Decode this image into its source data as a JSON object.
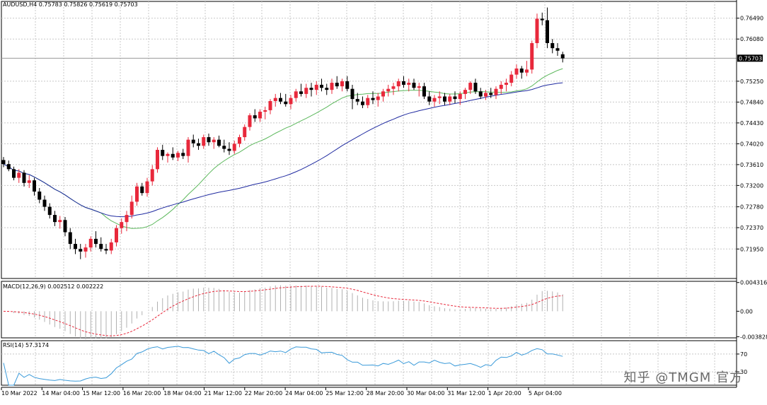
{
  "watermark": "知乎 @TMGM 官方",
  "chart_data": [
    {
      "type": "candlestick",
      "title": "AUDUSD,H4  0.75783 0.75826 0.75619 0.75703",
      "ylim": [
        0.7137,
        0.7682
      ],
      "y_ticks": [
        "0.76490",
        "0.76080",
        "0.75250",
        "0.74840",
        "0.74430",
        "0.74020",
        "0.73610",
        "0.73200",
        "0.72780",
        "0.72370",
        "0.71950"
      ],
      "current_price": "0.75703",
      "x_ticks": [
        "10 Mar 2022",
        "14 Mar 04:00",
        "15 Mar 12:00",
        "16 Mar 20:00",
        "18 Mar 04:00",
        "21 Mar 12:00",
        "22 Mar 20:00",
        "24 Mar 04:00",
        "25 Mar 12:00",
        "28 Mar 20:00",
        "30 Mar 04:00",
        "31 Mar 12:00",
        "1 Apr 20:00",
        "5 Apr 04:00"
      ],
      "up_color": "#e8283b",
      "down_color": "#000000",
      "candles": [
        [
          0.737,
          0.7376,
          0.7356,
          0.7362
        ],
        [
          0.7362,
          0.7369,
          0.7348,
          0.7352
        ],
        [
          0.7352,
          0.7357,
          0.733,
          0.7335
        ],
        [
          0.7335,
          0.7352,
          0.7325,
          0.7345
        ],
        [
          0.7345,
          0.735,
          0.7318,
          0.7325
        ],
        [
          0.7325,
          0.734,
          0.7315,
          0.733
        ],
        [
          0.733,
          0.7335,
          0.73,
          0.7308
        ],
        [
          0.7308,
          0.7315,
          0.7285,
          0.7292
        ],
        [
          0.7292,
          0.73,
          0.727,
          0.7278
        ],
        [
          0.7278,
          0.7285,
          0.7255,
          0.7262
        ],
        [
          0.7262,
          0.727,
          0.724,
          0.7248
        ],
        [
          0.7248,
          0.726,
          0.7235,
          0.7252
        ],
        [
          0.7252,
          0.7258,
          0.722,
          0.7228
        ],
        [
          0.7228,
          0.7236,
          0.7195,
          0.7205
        ],
        [
          0.7205,
          0.7215,
          0.7185,
          0.7195
        ],
        [
          0.7195,
          0.7205,
          0.7175,
          0.719
        ],
        [
          0.719,
          0.7205,
          0.7178,
          0.7198
        ],
        [
          0.7198,
          0.722,
          0.719,
          0.7215
        ],
        [
          0.7215,
          0.723,
          0.7198,
          0.7205
        ],
        [
          0.7205,
          0.7218,
          0.719,
          0.7195
        ],
        [
          0.7195,
          0.7205,
          0.7185,
          0.7192
        ],
        [
          0.7192,
          0.7215,
          0.7185,
          0.7208
        ],
        [
          0.7208,
          0.7242,
          0.72,
          0.7236
        ],
        [
          0.7236,
          0.7255,
          0.7225,
          0.7248
        ],
        [
          0.7248,
          0.727,
          0.723,
          0.7262
        ],
        [
          0.7262,
          0.73,
          0.7255,
          0.7288
        ],
        [
          0.7288,
          0.7325,
          0.728,
          0.7318
        ],
        [
          0.7318,
          0.7325,
          0.73,
          0.7305
        ],
        [
          0.7305,
          0.7335,
          0.7298,
          0.7328
        ],
        [
          0.7328,
          0.736,
          0.732,
          0.7352
        ],
        [
          0.7352,
          0.7395,
          0.7345,
          0.739
        ],
        [
          0.739,
          0.74,
          0.737,
          0.7378
        ],
        [
          0.7378,
          0.7385,
          0.7365,
          0.7382
        ],
        [
          0.7382,
          0.7395,
          0.737,
          0.7375
        ],
        [
          0.7375,
          0.7388,
          0.7368,
          0.7384
        ],
        [
          0.7384,
          0.7392,
          0.7372,
          0.7378
        ],
        [
          0.7378,
          0.7415,
          0.7365,
          0.741
        ],
        [
          0.741,
          0.742,
          0.7395,
          0.7403
        ],
        [
          0.7403,
          0.7412,
          0.739,
          0.7398
        ],
        [
          0.7398,
          0.742,
          0.7392,
          0.7415
        ],
        [
          0.7415,
          0.7422,
          0.7398,
          0.7405
        ],
        [
          0.7405,
          0.7415,
          0.7392,
          0.741
        ],
        [
          0.741,
          0.7418,
          0.7395,
          0.7398
        ],
        [
          0.7398,
          0.741,
          0.7385,
          0.7392
        ],
        [
          0.7392,
          0.7405,
          0.738,
          0.7388
        ],
        [
          0.7388,
          0.7408,
          0.7382,
          0.7402
        ],
        [
          0.7402,
          0.742,
          0.7395,
          0.7415
        ],
        [
          0.7415,
          0.744,
          0.7408,
          0.7435
        ],
        [
          0.7435,
          0.7462,
          0.7428,
          0.7458
        ],
        [
          0.7458,
          0.747,
          0.7445,
          0.7452
        ],
        [
          0.7452,
          0.747,
          0.7445,
          0.7465
        ],
        [
          0.7465,
          0.7475,
          0.745,
          0.7468
        ],
        [
          0.7468,
          0.749,
          0.746,
          0.7486
        ],
        [
          0.7486,
          0.75,
          0.7475,
          0.7492
        ],
        [
          0.7492,
          0.7502,
          0.748,
          0.7485
        ],
        [
          0.7485,
          0.75,
          0.7475,
          0.748
        ],
        [
          0.748,
          0.7498,
          0.747,
          0.7492
        ],
        [
          0.7492,
          0.751,
          0.7485,
          0.7505
        ],
        [
          0.7505,
          0.752,
          0.7495,
          0.75
        ],
        [
          0.75,
          0.752,
          0.7492,
          0.7512
        ],
        [
          0.7512,
          0.7522,
          0.7495,
          0.7508
        ],
        [
          0.7508,
          0.7525,
          0.7498,
          0.7518
        ],
        [
          0.7518,
          0.753,
          0.7505,
          0.7512
        ],
        [
          0.7512,
          0.752,
          0.7498,
          0.7508
        ],
        [
          0.7508,
          0.753,
          0.75,
          0.7522
        ],
        [
          0.7522,
          0.7535,
          0.751,
          0.7515
        ],
        [
          0.7515,
          0.753,
          0.7505,
          0.7525
        ],
        [
          0.7525,
          0.7535,
          0.7505,
          0.751
        ],
        [
          0.751,
          0.7518,
          0.747,
          0.749
        ],
        [
          0.749,
          0.7502,
          0.7478,
          0.7485
        ],
        [
          0.7485,
          0.7495,
          0.7472,
          0.7478
        ],
        [
          0.7478,
          0.7498,
          0.7472,
          0.7492
        ],
        [
          0.7492,
          0.7505,
          0.748,
          0.7488
        ],
        [
          0.7488,
          0.7502,
          0.7475,
          0.7495
        ],
        [
          0.7495,
          0.751,
          0.7485,
          0.7505
        ],
        [
          0.7505,
          0.7518,
          0.7495,
          0.751
        ],
        [
          0.751,
          0.7522,
          0.7498,
          0.7515
        ],
        [
          0.7515,
          0.753,
          0.7505,
          0.7525
        ],
        [
          0.7525,
          0.7535,
          0.7512,
          0.7518
        ],
        [
          0.7518,
          0.753,
          0.7505,
          0.7522
        ],
        [
          0.7522,
          0.753,
          0.7508,
          0.7512
        ],
        [
          0.7512,
          0.7522,
          0.7495,
          0.7515
        ],
        [
          0.7515,
          0.7522,
          0.749,
          0.7495
        ],
        [
          0.7495,
          0.7505,
          0.7478,
          0.7485
        ],
        [
          0.7485,
          0.7498,
          0.7475,
          0.7492
        ],
        [
          0.7492,
          0.7505,
          0.748,
          0.7495
        ],
        [
          0.7495,
          0.7502,
          0.7478,
          0.7485
        ],
        [
          0.7485,
          0.75,
          0.7478,
          0.7495
        ],
        [
          0.7495,
          0.7505,
          0.7482,
          0.749
        ],
        [
          0.749,
          0.7505,
          0.7478,
          0.75
        ],
        [
          0.75,
          0.7512,
          0.749,
          0.7508
        ],
        [
          0.7508,
          0.7525,
          0.75,
          0.7522
        ],
        [
          0.7522,
          0.753,
          0.75,
          0.7505
        ],
        [
          0.7505,
          0.7512,
          0.749,
          0.7495
        ],
        [
          0.7495,
          0.7508,
          0.7488,
          0.7502
        ],
        [
          0.7502,
          0.7512,
          0.7492,
          0.7498
        ],
        [
          0.7498,
          0.7515,
          0.749,
          0.751
        ],
        [
          0.751,
          0.7525,
          0.75,
          0.7518
        ],
        [
          0.7518,
          0.753,
          0.7505,
          0.7522
        ],
        [
          0.7522,
          0.7545,
          0.7515,
          0.7538
        ],
        [
          0.7538,
          0.7558,
          0.753,
          0.755
        ],
        [
          0.755,
          0.7555,
          0.753,
          0.7542
        ],
        [
          0.7542,
          0.7565,
          0.7535,
          0.7548
        ],
        [
          0.7548,
          0.7605,
          0.754,
          0.76
        ],
        [
          0.76,
          0.7658,
          0.759,
          0.7648
        ],
        [
          0.7648,
          0.766,
          0.7635,
          0.7645
        ],
        [
          0.7645,
          0.767,
          0.759,
          0.76
        ],
        [
          0.76,
          0.7608,
          0.758,
          0.759
        ],
        [
          0.759,
          0.76,
          0.7575,
          0.7585
        ],
        [
          0.7578,
          0.7583,
          0.7562,
          0.757
        ]
      ],
      "ma_fast_color": "#5cb85c",
      "ma_slow_color": "#1f2aa0"
    },
    {
      "type": "histogram",
      "title": "MACD(12,26,9) 0.002512 0.002222",
      "y_ticks": [
        "0.004316",
        "0.00",
        "-0.003828"
      ],
      "ylim": [
        -0.004,
        0.0045
      ],
      "bar_color": "#b0b0b0",
      "signal_color": "#e8283b"
    },
    {
      "type": "line",
      "title": "RSI(14) 57.3174",
      "y_ticks": [
        "70",
        "30"
      ],
      "ylim": [
        0,
        100
      ],
      "line_color": "#3a9ad9"
    }
  ]
}
